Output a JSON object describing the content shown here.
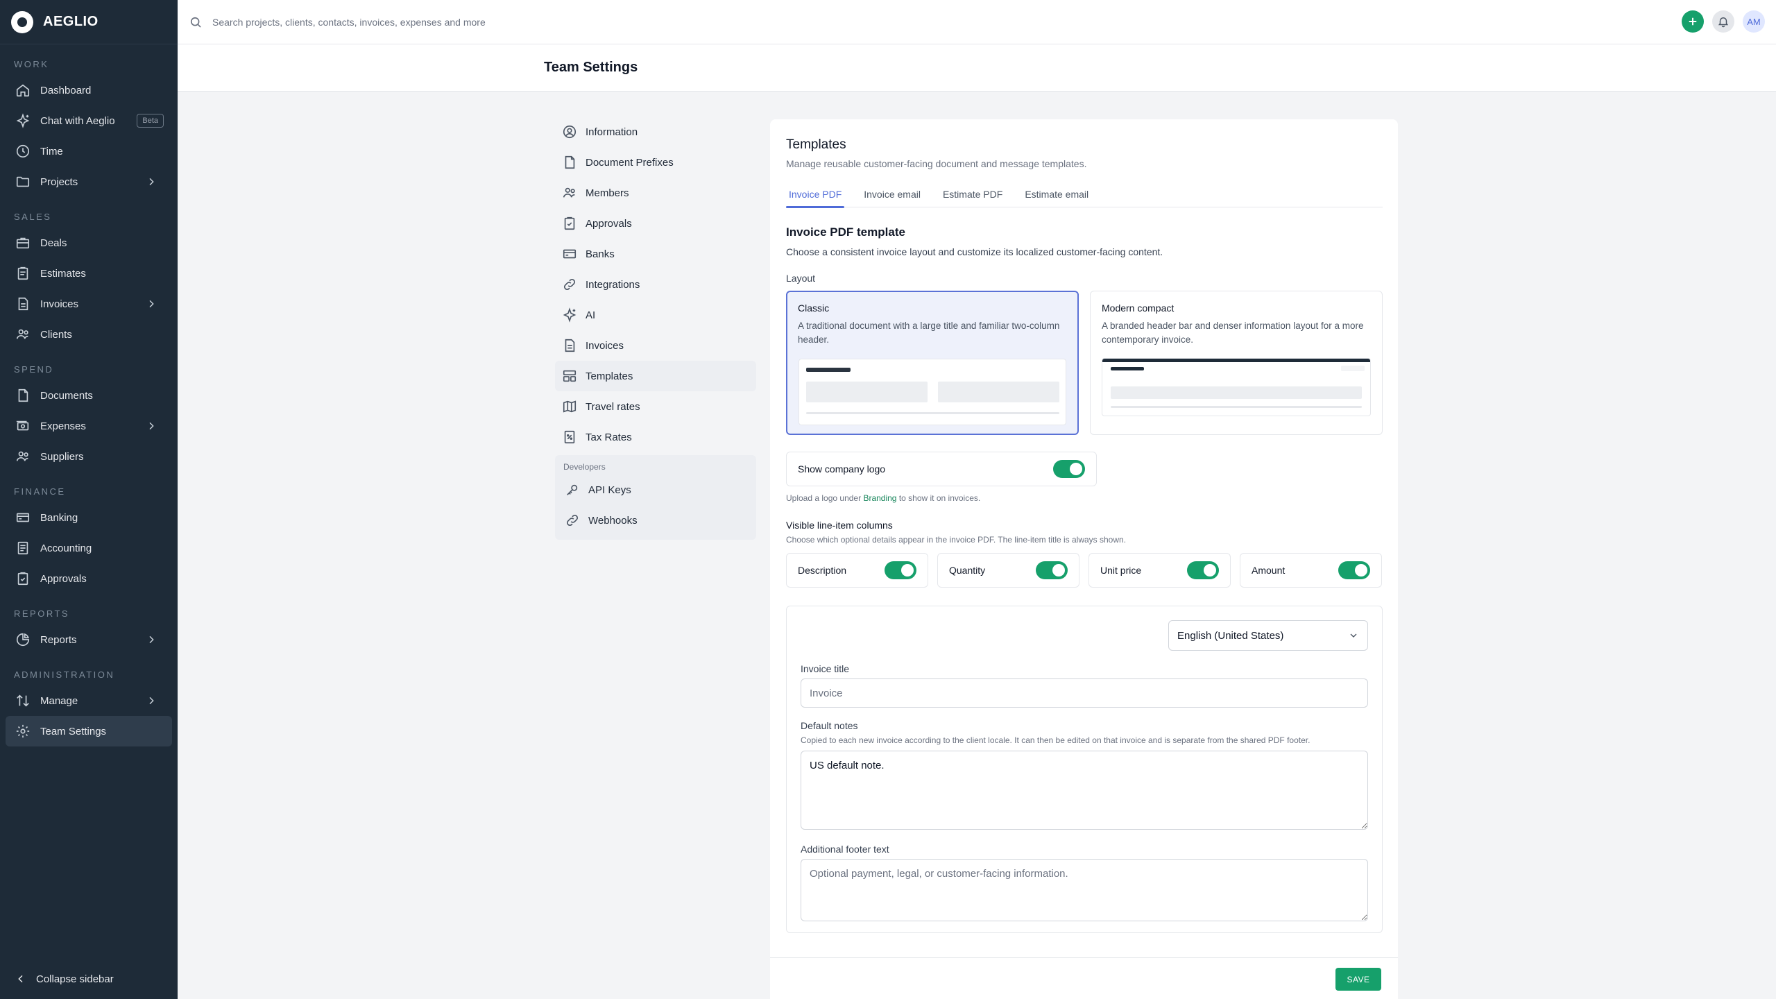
{
  "brand": {
    "name": "AEGLIO"
  },
  "sidebar": {
    "sections": {
      "work": "WORK",
      "sales": "SALES",
      "spend": "SPEND",
      "finance": "FINANCE",
      "reports": "REPORTS",
      "administration": "ADMINISTRATION"
    },
    "items": {
      "dashboard": "Dashboard",
      "chat": "Chat with Aeglio",
      "chat_badge": "Beta",
      "time": "Time",
      "projects": "Projects",
      "deals": "Deals",
      "estimates": "Estimates",
      "invoices": "Invoices",
      "clients": "Clients",
      "documents": "Documents",
      "expenses": "Expenses",
      "suppliers": "Suppliers",
      "banking": "Banking",
      "accounting": "Accounting",
      "approvals": "Approvals",
      "reports": "Reports",
      "manage": "Manage",
      "team_settings": "Team Settings"
    },
    "collapse": "Collapse sidebar"
  },
  "topbar": {
    "search_placeholder": "Search projects, clients, contacts, invoices, expenses and more",
    "avatar_initials": "AM"
  },
  "page": {
    "title": "Team Settings"
  },
  "settings_menu": {
    "items": {
      "information": "Information",
      "document_prefixes": "Document Prefixes",
      "members": "Members",
      "approvals": "Approvals",
      "banks": "Banks",
      "integrations": "Integrations",
      "ai": "AI",
      "invoices": "Invoices",
      "templates": "Templates",
      "travel_rates": "Travel rates",
      "tax_rates": "Tax Rates"
    },
    "developers_title": "Developers",
    "developers": {
      "api_keys": "API Keys",
      "webhooks": "Webhooks"
    }
  },
  "templates": {
    "title": "Templates",
    "subtitle": "Manage reusable customer-facing document and message templates.",
    "tabs": {
      "invoice_pdf": "Invoice PDF",
      "invoice_email": "Invoice email",
      "estimate_pdf": "Estimate PDF",
      "estimate_email": "Estimate email"
    },
    "section_title": "Invoice PDF template",
    "section_subtitle": "Choose a consistent invoice layout and customize its localized customer-facing content.",
    "layout_label": "Layout",
    "layouts": {
      "classic": {
        "title": "Classic",
        "description": "A traditional document with a large title and familiar two-column header."
      },
      "modern": {
        "title": "Modern compact",
        "description": "A branded header bar and denser information layout for a more contemporary invoice."
      }
    },
    "show_logo_label": "Show company logo",
    "logo_hint_pre": "Upload a logo under",
    "logo_hint_link": "Branding",
    "logo_hint_post": "to show it on invoices.",
    "columns_title": "Visible line-item columns",
    "columns_subtitle": "Choose which optional details appear in the invoice PDF. The line-item title is always shown.",
    "columns": {
      "description": "Description",
      "quantity": "Quantity",
      "unit_price": "Unit price",
      "amount": "Amount"
    },
    "locale": "English (United States)",
    "invoice_title_label": "Invoice title",
    "invoice_title_placeholder": "Invoice",
    "default_notes_label": "Default notes",
    "default_notes_hint": "Copied to each new invoice according to the client locale. It can then be edited on that invoice and is separate from the shared PDF footer.",
    "default_notes_value": "US default note.",
    "footer_label": "Additional footer text",
    "footer_placeholder": "Optional payment, legal, or customer-facing information.",
    "save": "SAVE"
  },
  "colors": {
    "sidebar_bg": "#1e2b38",
    "accent": "#16a06b",
    "tab_active": "#4f6bd8"
  }
}
